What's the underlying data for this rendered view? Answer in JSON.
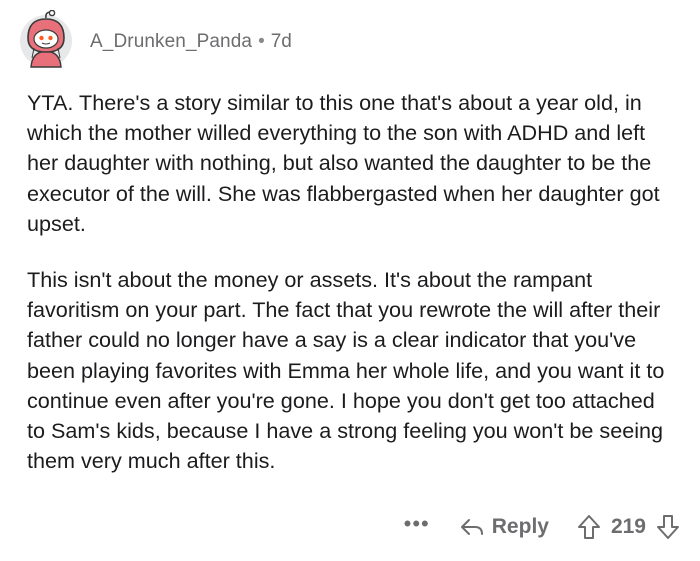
{
  "comment": {
    "author": "A_Drunken_Panda",
    "separator": "•",
    "age": "7d",
    "paragraphs": [
      "YTA. There's a story similar to this one that's about a year old, in which the mother willed everything to the son with ADHD and left her daughter with nothing, but also wanted the daughter to be the executor of the will. She was flabbergasted when her daughter got upset.",
      "This isn't about the money or assets. It's about the rampant favoritism on your part. The fact that you rewrote the will after their father could no longer have a say is a clear indicator that you've been playing favorites with Emma her whole life, and you want it to continue even after you're gone. I hope you don't get too attached to Sam's kids, because I have a strong feeling you won't be seeing them very much after this."
    ]
  },
  "actions": {
    "more_label": "•••",
    "reply_label": "Reply",
    "score": "219"
  },
  "icons": {
    "avatar": "snoo-avatar",
    "reply": "reply-arrow-icon",
    "upvote": "upvote-arrow-icon",
    "downvote": "downvote-arrow-icon"
  },
  "colors": {
    "text": "#1c1c1e",
    "meta": "#6d6d70",
    "avatar_bg": "#e7e8ea",
    "avatar_hood": "#e8707a"
  }
}
